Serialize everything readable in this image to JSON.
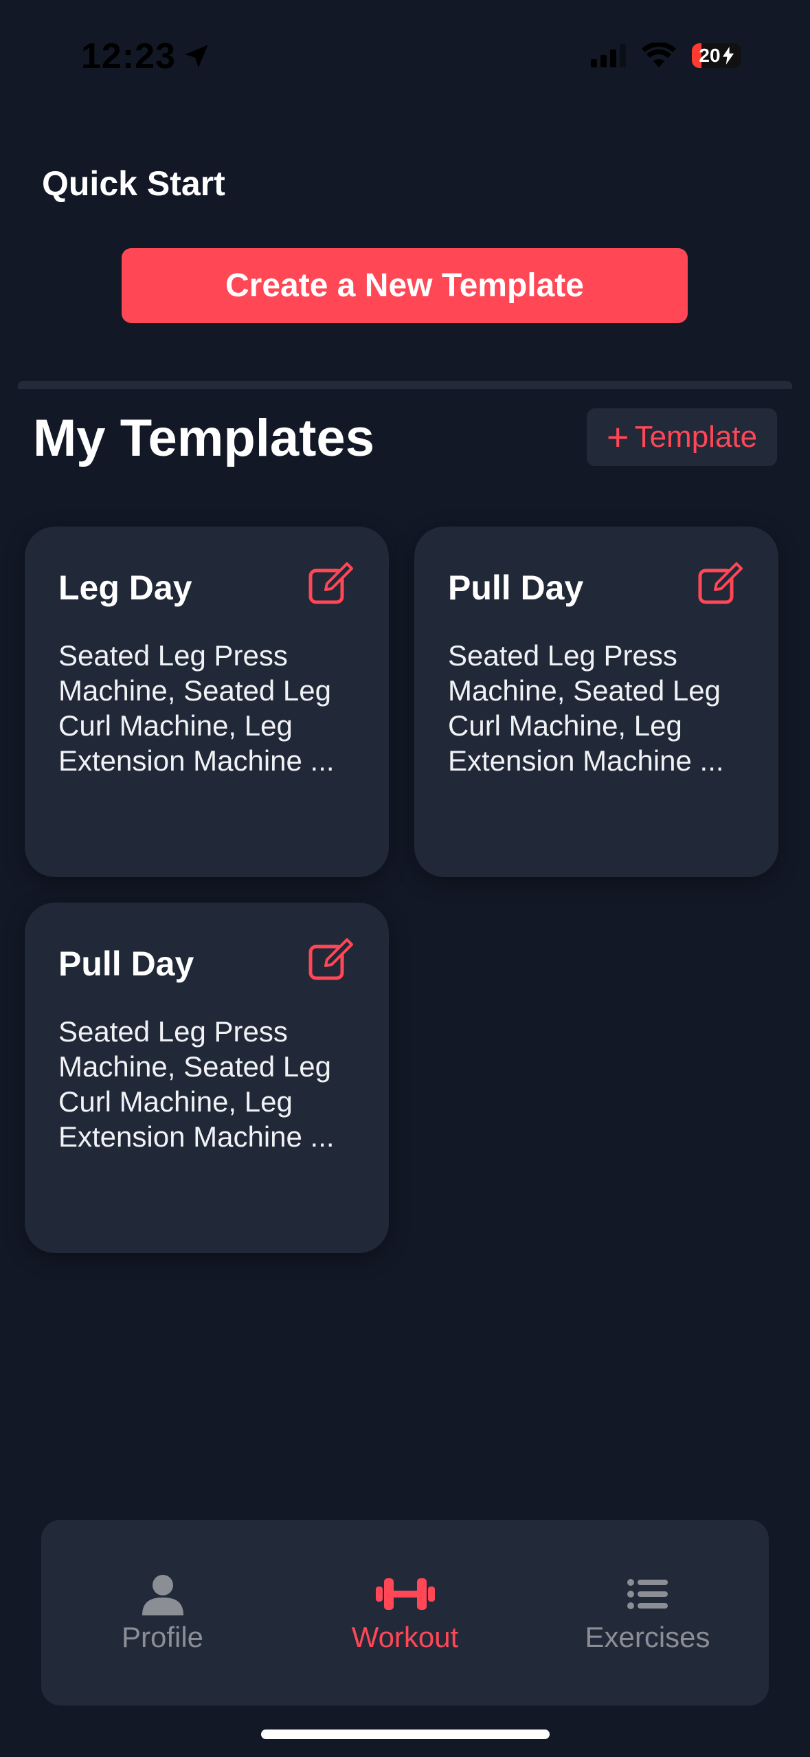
{
  "status_bar": {
    "time": "12:23",
    "battery_pct": "20",
    "battery_level": 0.2
  },
  "quick_start": {
    "title": "Quick Start",
    "create_button": "Create a New Template"
  },
  "templates_section": {
    "title": "My Templates",
    "add_button": "Template"
  },
  "templates": [
    {
      "name": "Leg Day",
      "exercises": "Seated Leg Press Machine, Seated Leg Curl Machine, Leg Extension Machine ..."
    },
    {
      "name": "Pull Day",
      "exercises": "Seated Leg Press Machine, Seated Leg Curl Machine, Leg Extension Machine ..."
    },
    {
      "name": "Pull Day",
      "exercises": "Seated Leg Press Machine, Seated Leg Curl Machine, Leg Extension Machine ..."
    }
  ],
  "tab_bar": {
    "active": "Workout",
    "tabs": [
      {
        "label": "Profile",
        "icon": "person-icon"
      },
      {
        "label": "Workout",
        "icon": "dumbbell-icon"
      },
      {
        "label": "Exercises",
        "icon": "list-icon"
      }
    ]
  },
  "colors": {
    "background": "#121826",
    "card": "#212837",
    "accent": "#ff4756",
    "inactive_tab": "#8b8e95"
  }
}
